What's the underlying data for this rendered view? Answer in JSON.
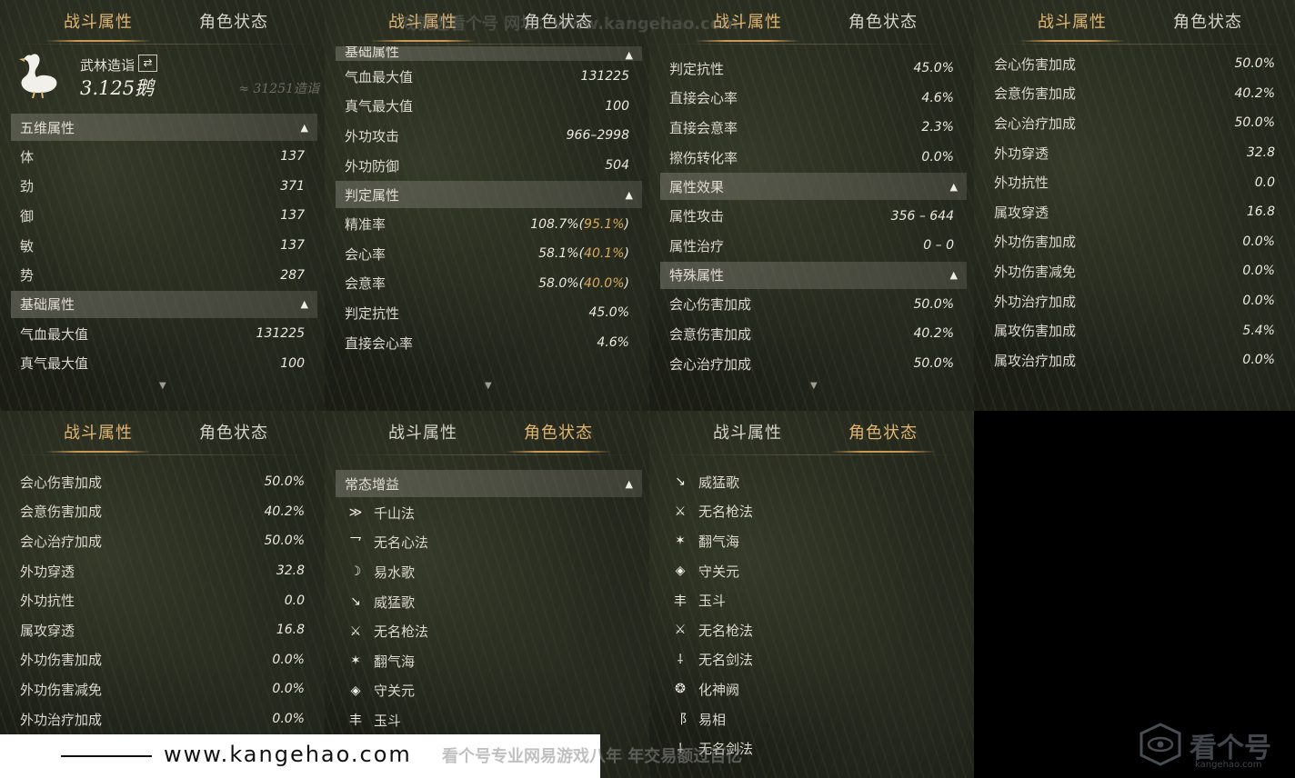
{
  "tabs": {
    "combat": "战斗属性",
    "status": "角色状态"
  },
  "profile": {
    "title": "武林造诣",
    "score": "3.125鹅",
    "approx": "≈ 31251造诣",
    "swap_icon": "swap-icon",
    "avatar_icon": "goose-icon"
  },
  "sections": {
    "five": "五维属性",
    "basic": "基础属性",
    "judge": "判定属性",
    "effect": "属性效果",
    "special": "特殊属性",
    "buffs": "常态增益"
  },
  "five_attrs": [
    {
      "label": "体",
      "value": "137"
    },
    {
      "label": "劲",
      "value": "371"
    },
    {
      "label": "御",
      "value": "137"
    },
    {
      "label": "敏",
      "value": "137"
    },
    {
      "label": "势",
      "value": "287"
    }
  ],
  "basic_attrs": [
    {
      "label": "气血最大值",
      "value": "131225"
    },
    {
      "label": "真气最大值",
      "value": "100"
    },
    {
      "label": "外功攻击",
      "value": "966–2998"
    },
    {
      "label": "外功防御",
      "value": "504"
    }
  ],
  "judge_attrs": [
    {
      "label": "精准率",
      "value": "108.7%",
      "paren": "95.1%"
    },
    {
      "label": "会心率",
      "value": "58.1%",
      "paren": "40.1%"
    },
    {
      "label": "会意率",
      "value": "58.0%",
      "paren": "40.0%"
    },
    {
      "label": "判定抗性",
      "value": "45.0%"
    },
    {
      "label": "直接会心率",
      "value": "4.6%"
    },
    {
      "label": "直接会意率",
      "value": "2.3%"
    },
    {
      "label": "擦伤转化率",
      "value": "0.0%"
    }
  ],
  "effect_attrs": [
    {
      "label": "属性攻击",
      "value": "356 – 644"
    },
    {
      "label": "属性治疗",
      "value": "0 – 0"
    }
  ],
  "special_attrs": [
    {
      "label": "会心伤害加成",
      "value": "50.0%"
    },
    {
      "label": "会意伤害加成",
      "value": "40.2%"
    },
    {
      "label": "会心治疗加成",
      "value": "50.0%"
    },
    {
      "label": "外功穿透",
      "value": "32.8"
    },
    {
      "label": "外功抗性",
      "value": "0.0"
    },
    {
      "label": "属攻穿透",
      "value": "16.8"
    },
    {
      "label": "外功伤害加成",
      "value": "0.0%"
    },
    {
      "label": "外功伤害减免",
      "value": "0.0%"
    },
    {
      "label": "外功治疗加成",
      "value": "0.0%"
    },
    {
      "label": "属攻伤害加成",
      "value": "5.4%"
    },
    {
      "label": "属攻治疗加成",
      "value": "0.0%"
    }
  ],
  "buffs_a": [
    {
      "label": "千山法",
      "icon": "bird-icon",
      "glyph": "≫"
    },
    {
      "label": "无名心法",
      "icon": "figure-icon",
      "glyph": "⺂"
    },
    {
      "label": "易水歌",
      "icon": "spirit-icon",
      "glyph": "☽"
    },
    {
      "label": "威猛歌",
      "icon": "blade-icon",
      "glyph": "↘"
    },
    {
      "label": "无名枪法",
      "icon": "spear-icon",
      "glyph": "⚔"
    },
    {
      "label": "翻气海",
      "icon": "burst-icon",
      "glyph": "✶"
    },
    {
      "label": "守关元",
      "icon": "shield-icon",
      "glyph": "◈"
    },
    {
      "label": "玉斗",
      "icon": "dipper-icon",
      "glyph": "丰"
    }
  ],
  "buffs_b": [
    {
      "label": "威猛歌",
      "icon": "blade-icon",
      "glyph": "↘"
    },
    {
      "label": "无名枪法",
      "icon": "spear-icon",
      "glyph": "⚔"
    },
    {
      "label": "翻气海",
      "icon": "burst-icon",
      "glyph": "✶"
    },
    {
      "label": "守关元",
      "icon": "shield-icon",
      "glyph": "◈"
    },
    {
      "label": "玉斗",
      "icon": "dipper-icon",
      "glyph": "丰"
    },
    {
      "label": "无名枪法",
      "icon": "spear-icon",
      "glyph": "⚔"
    },
    {
      "label": "无名剑法",
      "icon": "sword-icon",
      "glyph": "⸸"
    },
    {
      "label": "化神阙",
      "icon": "spirit2-icon",
      "glyph": "❂"
    },
    {
      "label": "易相",
      "icon": "change-icon",
      "glyph": "⻏"
    },
    {
      "label": "无名剑法",
      "icon": "sword-icon",
      "glyph": "⸸"
    }
  ],
  "watermark": {
    "url": "www.kangehao.com",
    "slogan": "看个号专业网易游戏八年  年交易额过百亿",
    "top_text": "戏就选看个号  网址：www.kangehao.com",
    "logo_name": "看个号",
    "logo_domain": "kangehao.com"
  },
  "colors": {
    "accent": "#e0b574",
    "paren_value": "#d9a860",
    "section_bg": "#6e6e64"
  }
}
